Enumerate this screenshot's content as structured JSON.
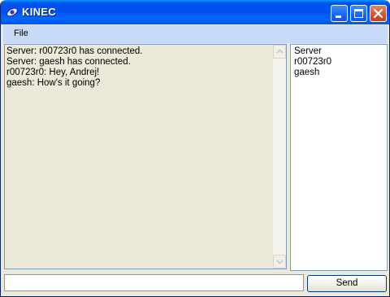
{
  "window": {
    "title": "KINEC",
    "controls": {
      "minimize": "minimize-icon",
      "maximize": "maximize-icon",
      "close": "close-icon"
    }
  },
  "menubar": {
    "items": [
      {
        "label": "File"
      }
    ]
  },
  "chat": {
    "lines": [
      "Server: r00723r0 has connected.",
      "Server: gaesh has connected.",
      "r00723r0: Hey, Andrej!",
      "gaesh: How's it going?"
    ]
  },
  "users": {
    "items": [
      "Server",
      "r00723r0",
      "gaesh"
    ]
  },
  "composer": {
    "input_value": "",
    "send_label": "Send"
  }
}
